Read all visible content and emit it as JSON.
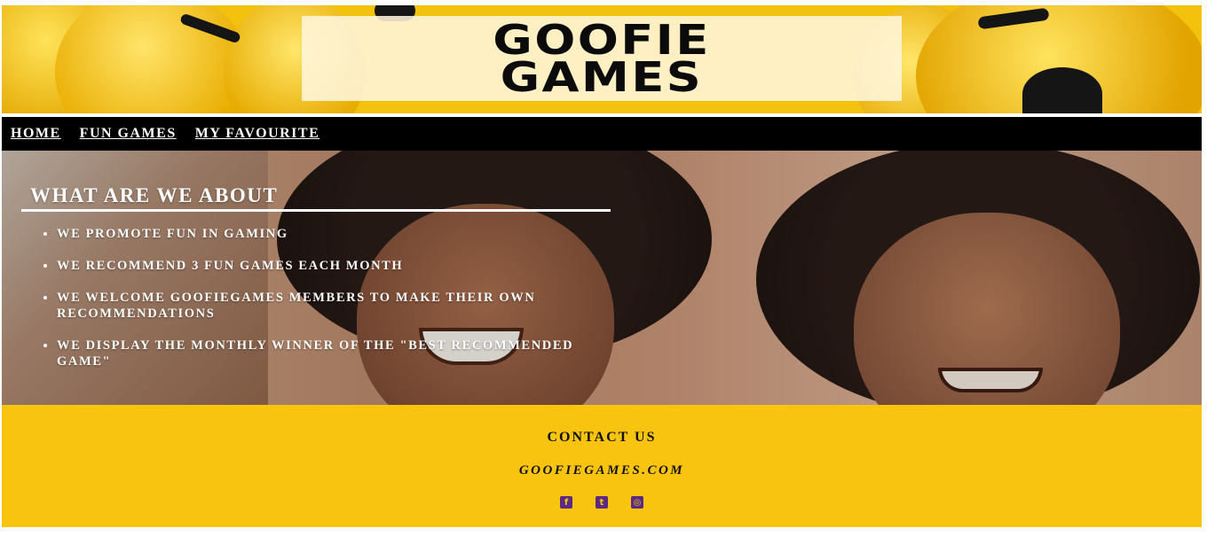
{
  "brand": {
    "logo_line1": "GOOFIE",
    "logo_line2": "GAMES"
  },
  "nav": {
    "items": [
      "HOME",
      "FUN GAMES",
      "MY FAVOURITE"
    ]
  },
  "about": {
    "title": "WHAT ARE WE ABOUT",
    "points": [
      "WE PROMOTE FUN IN GAMING",
      "WE RECOMMEND 3 FUN GAMES EACH MONTH",
      "WE WELCOME GOOFIEGAMES MEMBERS TO MAKE THEIR OWN RECOMMENDATIONS",
      "WE DISPLAY THE MONTHLY WINNER OF THE \"BEST RECOMMENDED GAME\""
    ]
  },
  "footer": {
    "contact_title": "CONTACT US",
    "website": "GOOFIEGAMES.COM",
    "socials": [
      {
        "icon": "facebook-icon",
        "glyph": "f"
      },
      {
        "icon": "twitter-icon",
        "glyph": "t"
      },
      {
        "icon": "instagram-icon",
        "glyph": "◎"
      }
    ]
  },
  "colors": {
    "header_yellow": "#f3c20c",
    "nav_bg": "#000000",
    "footer_yellow": "#f8c40f",
    "social_purple": "#5a2a83"
  }
}
